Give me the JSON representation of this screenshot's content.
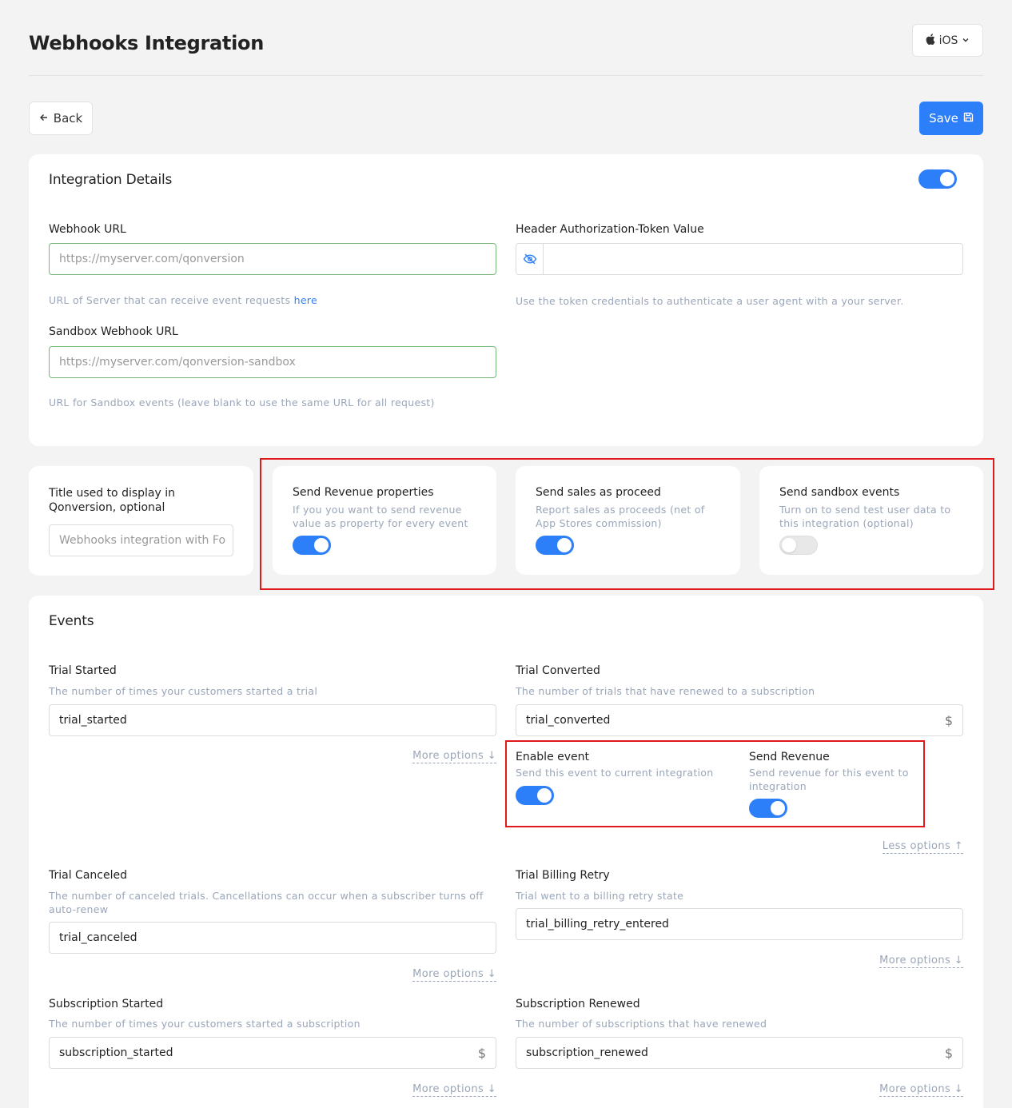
{
  "header": {
    "title": "Webhooks Integration",
    "platform": "iOS",
    "back_label": "Back",
    "save_label": "Save"
  },
  "integration": {
    "title": "Integration Details",
    "enabled": true,
    "webhook_url": {
      "label": "Webhook URL",
      "placeholder": "https://myserver.com/qonversion",
      "hint": "URL of Server that can receive event requests",
      "hint_link": "here"
    },
    "token": {
      "label": "Header Authorization-Token Value",
      "hint": "Use the token credentials to authenticate a user agent with a your server."
    },
    "sandbox_url": {
      "label": "Sandbox Webhook URL",
      "placeholder": "https://myserver.com/qonversion-sandbox",
      "hint": "URL for Sandbox events (leave blank to use the same URL for all request)"
    }
  },
  "settings": {
    "display_title": {
      "label": "Title used to display in Qonversion, optional",
      "placeholder": "Webhooks integration with Fo"
    },
    "revenue_props": {
      "title": "Send Revenue properties",
      "hint": "If you you want to send revenue value as property for every event",
      "enabled": true
    },
    "sales_proceed": {
      "title": "Send sales as proceed",
      "hint": "Report sales as proceeds (net of App Stores commission)",
      "enabled": true
    },
    "sandbox_events": {
      "title": "Send sandbox events",
      "hint": "Turn on to send test user data to this integration (optional)",
      "enabled": false
    }
  },
  "events": {
    "title": "Events",
    "more_options": "More options ↓",
    "less_options": "Less options ↑",
    "trial_started": {
      "label": "Trial Started",
      "hint": "The number of times your customers started a trial",
      "value": "trial_started"
    },
    "trial_converted": {
      "label": "Trial Converted",
      "hint": "The number of trials that have renewed to a subscription",
      "value": "trial_converted",
      "enable_event": {
        "label": "Enable event",
        "hint": "Send this event to current integration",
        "enabled": true
      },
      "send_revenue": {
        "label": "Send Revenue",
        "hint": "Send revenue for this event to integration",
        "enabled": true
      }
    },
    "trial_canceled": {
      "label": "Trial Canceled",
      "hint": "The number of canceled trials. Cancellations can occur when a subscriber turns off auto-renew",
      "value": "trial_canceled"
    },
    "trial_billing_retry": {
      "label": "Trial Billing Retry",
      "hint": "Trial went to a billing retry state",
      "value": "trial_billing_retry_entered"
    },
    "subscription_started": {
      "label": "Subscription Started",
      "hint": "The number of times your customers started a subscription",
      "value": "subscription_started"
    },
    "subscription_renewed": {
      "label": "Subscription Renewed",
      "hint": "The number of subscriptions that have renewed",
      "value": "subscription_renewed"
    }
  },
  "icons": {
    "currency": "$"
  }
}
